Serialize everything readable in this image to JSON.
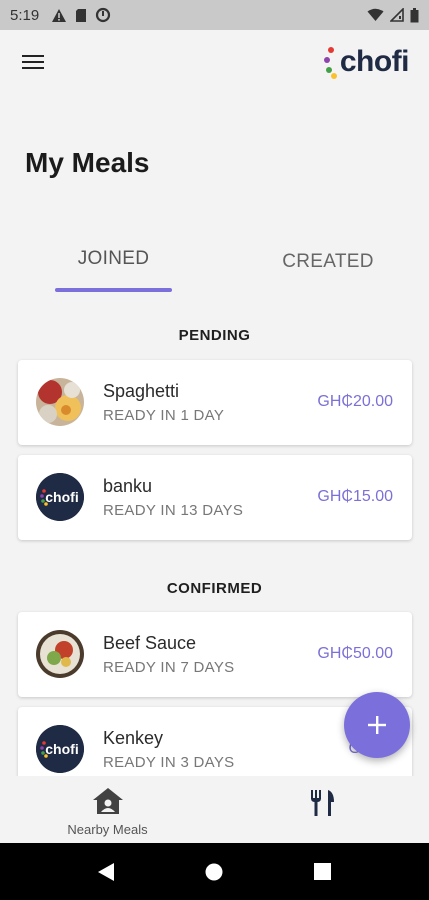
{
  "status_bar": {
    "time": "5:19",
    "left_icons": [
      "warning-icon",
      "sd-card-icon",
      "sync-icon"
    ],
    "right_icons": [
      "wifi-icon",
      "signal-icon",
      "battery-icon"
    ]
  },
  "app_bar": {
    "menu_icon": "hamburger-menu-icon",
    "logo_text": "chofi"
  },
  "page": {
    "title": "My Meals"
  },
  "tabs": [
    {
      "label": "JOINED",
      "selected": true
    },
    {
      "label": "CREATED",
      "selected": false
    }
  ],
  "sections": {
    "pending": "PENDING",
    "confirmed": "CONFIRMED"
  },
  "meals": {
    "pending": [
      {
        "name": "Spaghetti",
        "status": "READY IN 1 DAY",
        "price": "GH₵20.00",
        "image": "food-photo"
      },
      {
        "name": "banku",
        "status": "READY IN 13 DAYS",
        "price": "GH₵15.00",
        "image": "chofi-logo"
      }
    ],
    "confirmed": [
      {
        "name": "Beef Sauce",
        "status": "READY IN 7 DAYS",
        "price": "GH₵50.00",
        "image": "food-photo"
      },
      {
        "name": "Kenkey",
        "status": "READY IN 3 DAYS",
        "price": "GH₵1",
        "image": "chofi-logo"
      }
    ]
  },
  "fab": {
    "icon": "plus-icon"
  },
  "bottom_nav": {
    "nearby_label": "Nearby Meals",
    "nearby_icon": "house-icon",
    "meals_icon": "fork-knife-icon"
  },
  "colors": {
    "accent": "#7b6fdc",
    "price": "#7b70d6",
    "logo_dark": "#1f2a44"
  }
}
